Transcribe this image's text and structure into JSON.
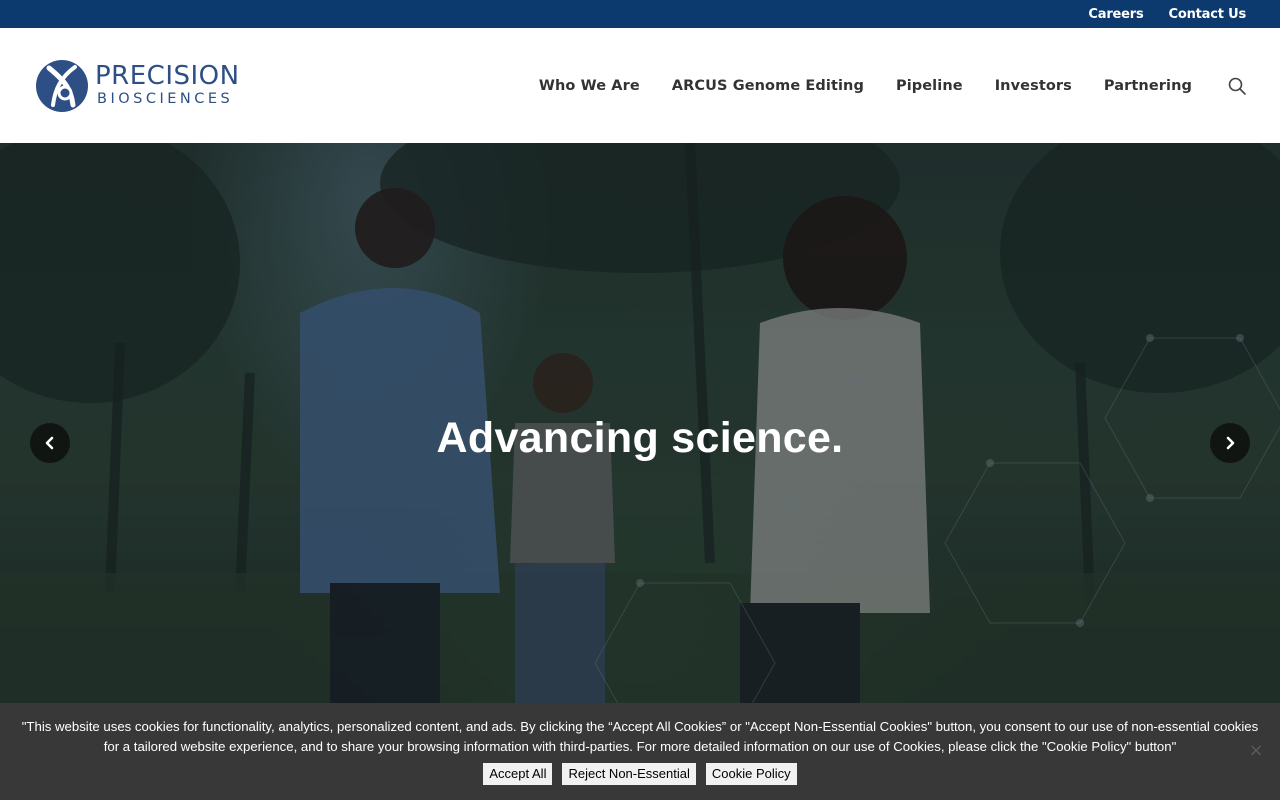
{
  "utility_nav": {
    "careers": "Careers",
    "contact": "Contact Us"
  },
  "brand": {
    "name_line1": "PRECISION",
    "name_line2": "BIOSCIENCES",
    "color": "#2e4f86"
  },
  "nav": {
    "items": [
      "Who We Are",
      "ARCUS Genome Editing",
      "Pipeline",
      "Investors",
      "Partnering"
    ],
    "search_icon": "search-icon"
  },
  "hero": {
    "headline": "Advancing science.",
    "prev_icon": "chevron-left-icon",
    "next_icon": "chevron-right-icon"
  },
  "cookie_banner": {
    "message": "\"This website uses cookies for functionality, analytics, personalized content, and ads. By clicking the “Accept All Cookies” or \"Accept Non-Essential Cookies\" button, you consent to our use of non-essential cookies for a tailored website experience, and to share your browsing information with third-parties. For more detailed information on our use of Cookies, please click the \"Cookie Policy\" button\"",
    "accept_label": "Accept All",
    "reject_label": "Reject Non-Essential",
    "policy_label": "Cookie Policy",
    "close_icon": "close-icon"
  },
  "colors": {
    "topbar": "#0c3a6e",
    "cookie_bg": "#383838",
    "nav_text": "#333333"
  }
}
